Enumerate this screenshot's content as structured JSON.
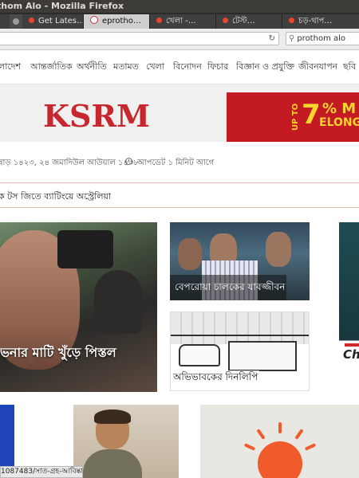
{
  "window": {
    "title": "thom Alo - Mozilla Firefox"
  },
  "tabs": [
    {
      "label": "Get Lates…",
      "icon": "record-dot-icon"
    },
    {
      "label": "eprotho…",
      "icon": "google-icon"
    },
    {
      "label": "খেলা -…",
      "icon": "record-dot-icon"
    },
    {
      "label": "টেস্ট…",
      "icon": "record-dot-icon"
    },
    {
      "label": "চড়-থাপ…",
      "icon": "record-dot-icon"
    }
  ],
  "navbar": {
    "reload_icon": "reload-icon",
    "search_value": "prothom alo"
  },
  "menu": [
    "লাদেশ",
    "আন্তর্জাতিক",
    "অর্থনীতি",
    "মতামত",
    "খেলা",
    "বিনোদন",
    "ফিচার",
    "বিজ্ঞান ও প্রযুক্তি",
    "জীবনযাপন",
    "ছবি"
  ],
  "ad": {
    "logo": "KSRM",
    "upto": "UP TO",
    "percent": "7",
    "pct_suffix": "% M",
    "elong": "ELONG"
  },
  "date_row": {
    "date": "ষাড় ১৪২৩, ২৪ জমাদিউল আউয়াল ১৪৩৮",
    "updated": "আপডেট ১ মিনিট আগে"
  },
  "breaking": {
    "text": "ক টস জিতে ব্যাটিংয়ে অস্ট্রেলিয়া"
  },
  "lead": {
    "title": "ভনার মাটি খুঁড়ে পিস্তল"
  },
  "stories": [
    {
      "title": "বেপরোয়া চালকের যাবজ্জীবন"
    },
    {
      "title": "অভিভাবকের দিনলিপি"
    }
  ],
  "side": {
    "label": "Ch"
  },
  "status": {
    "url": "1087483/সাত-গ্রহ-আবিষ্কার"
  },
  "colors": {
    "accent": "#c41a24",
    "ad_text": "#f7d52d",
    "sun": "#f15a2b",
    "bluebox": "#1f43b9"
  }
}
